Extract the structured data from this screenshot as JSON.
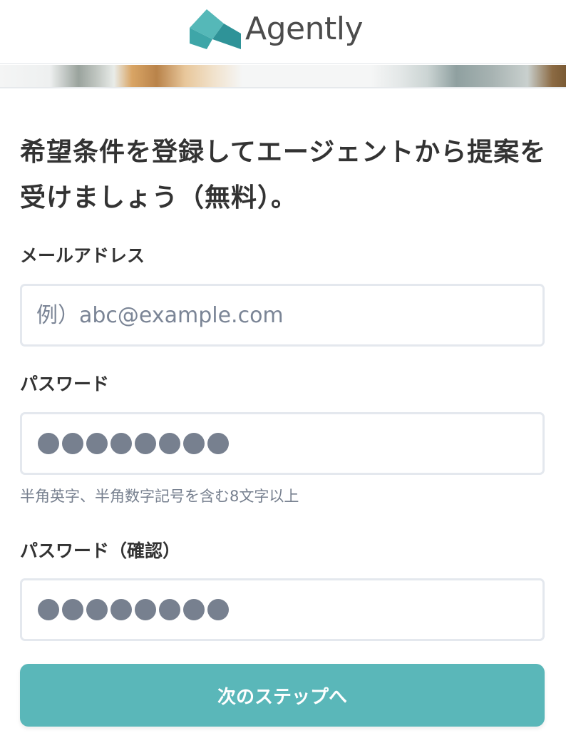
{
  "brand": {
    "name": "Agently",
    "logo_icon": "agently-logo-icon",
    "colors": {
      "accent": "#5ab7b9",
      "logo_teal": "#4fb3b3",
      "logo_teal_dark": "#2f8f94"
    }
  },
  "heading": "希望条件を登録してエージェントから提案を受けましょう（無料）。",
  "form": {
    "email": {
      "label": "メールアドレス",
      "placeholder": "例）abc@example.com",
      "value": ""
    },
    "password": {
      "label": "パスワード",
      "masked_length": 8,
      "hint": "半角英字、半角数字記号を含む8文字以上"
    },
    "password_confirm": {
      "label": "パスワード（確認）",
      "masked_length": 8
    },
    "submit_label": "次のステップへ"
  }
}
